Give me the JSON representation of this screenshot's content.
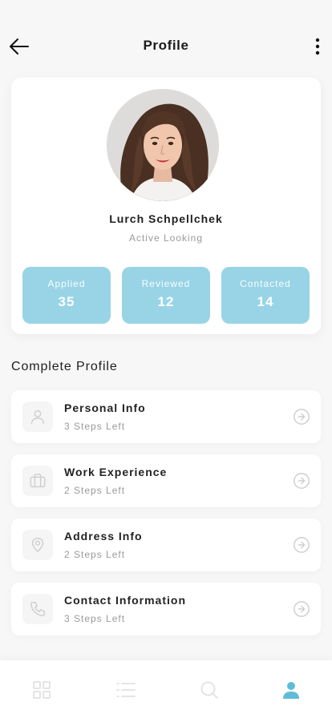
{
  "header": {
    "title": "Profile",
    "back_icon": "arrow-left-icon",
    "more_icon": "more-vertical-icon"
  },
  "profile": {
    "name": "Lurch Schpellchek",
    "status": "Active Looking",
    "stats": [
      {
        "label": "Applied",
        "value": "35"
      },
      {
        "label": "Reviewed",
        "value": "12"
      },
      {
        "label": "Contacted",
        "value": "14"
      }
    ]
  },
  "complete_profile": {
    "title": "Complete Profile",
    "items": [
      {
        "title": "Personal Info",
        "subtitle": "3 Steps Left",
        "icon": "user-icon"
      },
      {
        "title": "Work Experience",
        "subtitle": "2 Steps Left",
        "icon": "briefcase-icon"
      },
      {
        "title": "Address Info",
        "subtitle": "2 Steps Left",
        "icon": "map-pin-icon"
      },
      {
        "title": "Contact Information",
        "subtitle": "3 Steps Left",
        "icon": "phone-icon"
      }
    ]
  },
  "bottom_nav": {
    "items": [
      {
        "icon": "grid-icon",
        "active": false
      },
      {
        "icon": "list-icon",
        "active": false
      },
      {
        "icon": "search-icon",
        "active": false
      },
      {
        "icon": "user-icon",
        "active": true
      }
    ]
  },
  "colors": {
    "accent": "#98d4e6",
    "active_nav": "#5fbcd9",
    "inactive_nav": "#e1e1e1",
    "background": "#f7f7f7"
  }
}
